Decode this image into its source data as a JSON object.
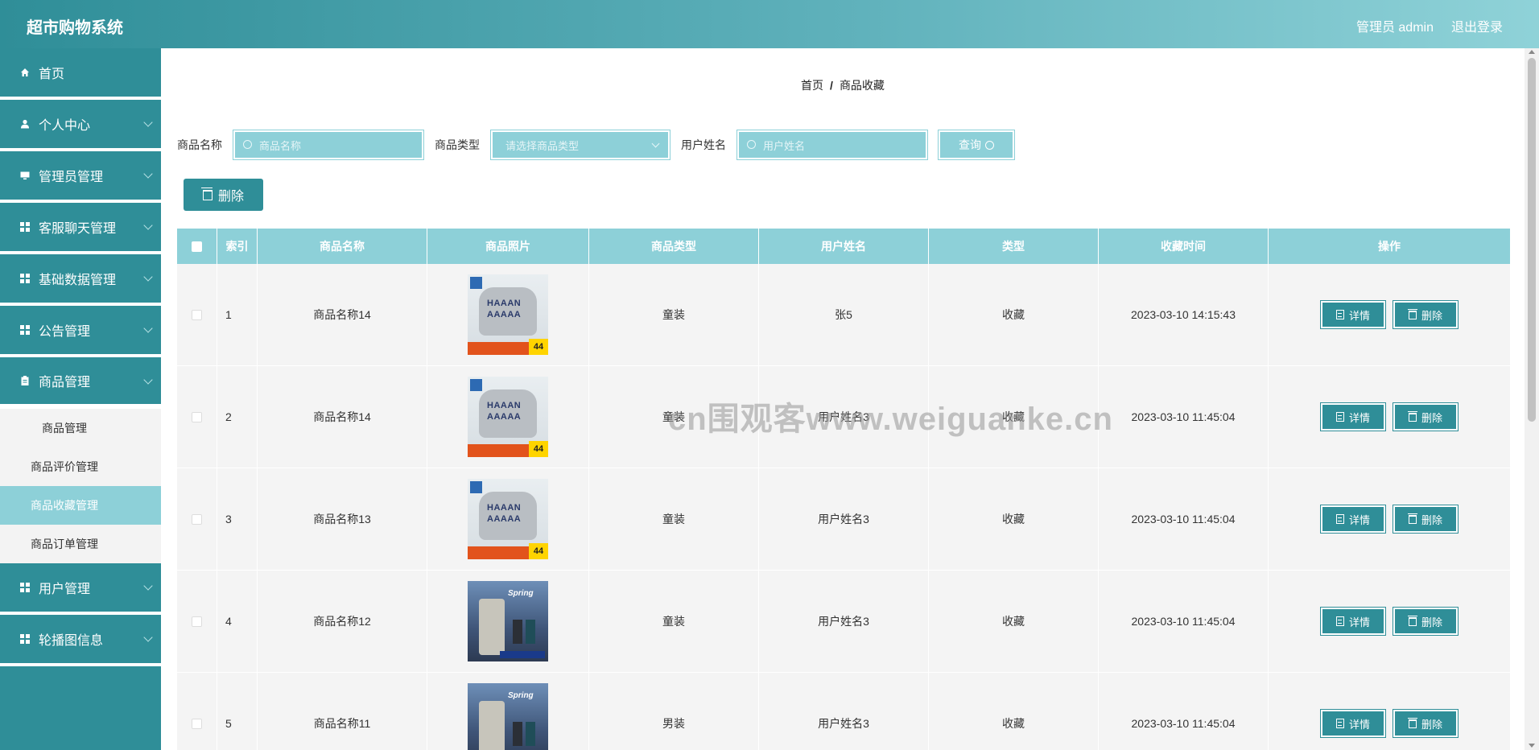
{
  "app": {
    "title": "超市购物系统"
  },
  "header": {
    "user_label": "管理员 admin",
    "logout_label": "退出登录"
  },
  "sidebar": {
    "items": [
      {
        "label": "首页",
        "icon": "home-icon",
        "expandable": false
      },
      {
        "label": "个人中心",
        "icon": "user-icon",
        "expandable": true
      },
      {
        "label": "管理员管理",
        "icon": "monitor-icon",
        "expandable": true
      },
      {
        "label": "客服聊天管理",
        "icon": "grid-icon",
        "expandable": true
      },
      {
        "label": "基础数据管理",
        "icon": "grid-icon",
        "expandable": true
      },
      {
        "label": "公告管理",
        "icon": "grid-icon",
        "expandable": true
      },
      {
        "label": "商品管理",
        "icon": "clipboard-icon",
        "expandable": true,
        "expanded": true
      },
      {
        "label": "用户管理",
        "icon": "grid-icon",
        "expandable": true
      },
      {
        "label": "轮播图信息",
        "icon": "grid-icon",
        "expandable": true
      }
    ],
    "submenu": [
      {
        "label": "商品管理"
      },
      {
        "label": "商品评价管理"
      },
      {
        "label": "商品收藏管理",
        "active": true
      },
      {
        "label": "商品订单管理"
      }
    ]
  },
  "breadcrumb": {
    "home": "首页",
    "separator": "/",
    "current": "商品收藏"
  },
  "search": {
    "name_label": "商品名称",
    "name_placeholder": "商品名称",
    "type_label": "商品类型",
    "type_placeholder": "请选择商品类型",
    "user_label": "用户姓名",
    "user_placeholder": "用户姓名",
    "query_label": "查询"
  },
  "toolbar": {
    "delete_label": "删除"
  },
  "table": {
    "columns": [
      "索引",
      "商品名称",
      "商品照片",
      "商品类型",
      "用户姓名",
      "类型",
      "收藏时间",
      "操作"
    ],
    "rows": [
      {
        "index": "1",
        "name": "商品名称14",
        "photo": "sweater",
        "category": "童装",
        "user": "张5",
        "type": "收藏",
        "time": "2023-03-10 14:15:43"
      },
      {
        "index": "2",
        "name": "商品名称14",
        "photo": "sweater",
        "category": "童装",
        "user": "用户姓名3",
        "type": "收藏",
        "time": "2023-03-10 11:45:04"
      },
      {
        "index": "3",
        "name": "商品名称13",
        "photo": "sweater",
        "category": "童装",
        "user": "用户姓名3",
        "type": "收藏",
        "time": "2023-03-10 11:45:04"
      },
      {
        "index": "4",
        "name": "商品名称12",
        "photo": "pants",
        "category": "童装",
        "user": "用户姓名3",
        "type": "收藏",
        "time": "2023-03-10 11:45:04"
      },
      {
        "index": "5",
        "name": "商品名称11",
        "photo": "pants",
        "category": "男装",
        "user": "用户姓名3",
        "type": "收藏",
        "time": "2023-03-10 11:45:04"
      }
    ],
    "detail_label": "详情",
    "delete_label": "删除"
  },
  "photo_text": {
    "sweater_price": "44",
    "pants_title": "Spring"
  },
  "watermark": "cn围观客www.weiguanke.cn",
  "colors": {
    "primary": "#2f8e98",
    "accent_light": "#8dd0d8"
  }
}
